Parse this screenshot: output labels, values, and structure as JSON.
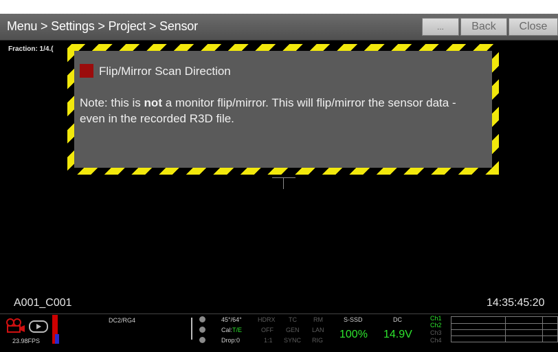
{
  "titlebar": {
    "breadcrumb": "Menu > Settings > Project > Sensor",
    "more_label": "...",
    "back_label": "Back",
    "close_label": "Close"
  },
  "viewport": {
    "fraction": "Fraction: 1/4.(",
    "clip_name": "A001_C001",
    "timecode": "14:35:45:20"
  },
  "tooltip": {
    "title": "Flip/Mirror Scan Direction",
    "body_prefix": "Note: this is ",
    "body_bold": "not",
    "body_suffix": " a monitor flip/mirror.  This will flip/mirror the sensor data - even in the recorded R3D file.",
    "swatch_color": "#9b0c0c",
    "stripe_color": "#f2e80c"
  },
  "status": {
    "fps": "23.98FPS",
    "record_color": "#d01010",
    "format": "DC2/RG4",
    "shutter": "45°/64°",
    "cal_label": "Cal:",
    "cal_value": "T/E",
    "drop": "Drop:0",
    "hdrx": "HDRX",
    "hdrx_val": "OFF",
    "ratio": "1:1",
    "tc": "TC",
    "tc_val": "GEN",
    "sync": "SYNC",
    "rm": "RM",
    "lan": "LAN",
    "rig": "RIG",
    "media_label": "S-SSD",
    "media_value": "100%",
    "power_label": "DC",
    "power_value": "14.9V",
    "channels": [
      "Ch1",
      "Ch2",
      "Ch3",
      "Ch4"
    ],
    "accent_green": "#2ee62e"
  },
  "icons": [
    "camera-icon",
    "play-icon",
    "histogram",
    "crosshair"
  ]
}
